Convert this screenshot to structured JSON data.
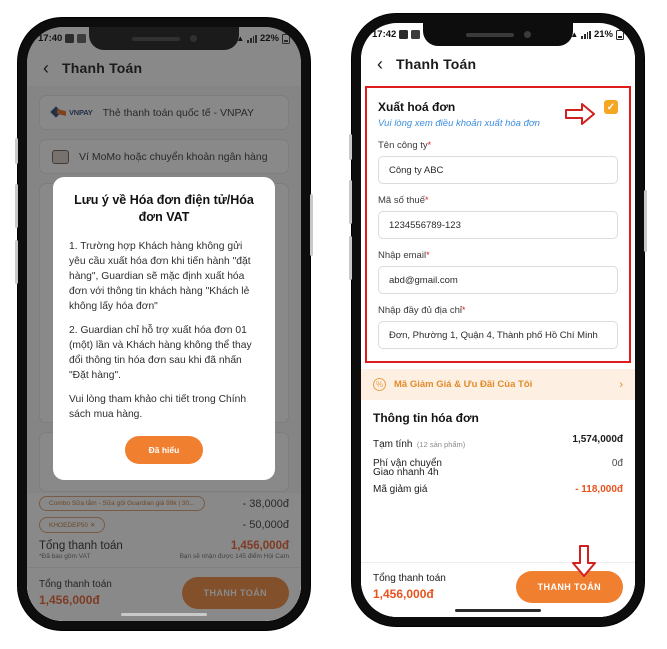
{
  "left_phone": {
    "status_bar": {
      "time": "17:40",
      "battery": "22%"
    },
    "header": {
      "back_icon": "chevron-left-icon",
      "title": "Thanh Toán"
    },
    "payment_options": [
      {
        "icon": "vnpay-logo-icon",
        "brand": "VNPAY",
        "label": "Thẻ thanh toán quốc tế - VNPAY"
      },
      {
        "icon": "momo-wallet-icon",
        "brand": "",
        "label": "Ví MoMo hoặc chuyển khoản ngân hàng"
      }
    ],
    "modal": {
      "title": "Lưu ý về Hóa đơn điện tử/Hóa đơn VAT",
      "paragraph_1": "1. Trường hợp Khách hàng không gửi yêu cầu xuất hóa đơn khi tiến hành \"đặt hàng\", Guardian sẽ mặc định xuất hóa đơn với thông tin khách hàng \"Khách lẻ không lấy hóa đơn\"",
      "paragraph_2": "2. Guardian chỉ hỗ trợ xuất hóa đơn 01 (một) lần và Khách hàng không thể thay đổi thông tin hóa đơn sau khi đã nhấn \"Đặt hàng\".",
      "paragraph_3": "Vui lòng tham khảo chi tiết trong Chính sách mua hàng.",
      "button_label": "Đã hiểu"
    },
    "summary": {
      "coupons": [
        {
          "chip": "Combo Sữa tắm - Sữa gội Guardian giá 99k | 30...",
          "value": "- 38,000đ"
        },
        {
          "chip": "KHOEDEP50  ✕",
          "value": "- 50,000đ"
        }
      ],
      "total_label": "Tổng thanh toán",
      "total_value": "1,456,000đ",
      "vat_note": "*Đã bao gồm VAT",
      "points_note": "Bạn sẽ nhận được 145 điểm Hội Cam"
    },
    "bottom_bar": {
      "total_label": "Tổng thanh toán",
      "total_value": "1,456,000đ",
      "pay_button": "THANH TOÁN"
    }
  },
  "right_phone": {
    "status_bar": {
      "time": "17:42",
      "battery": "21%"
    },
    "header": {
      "back_icon": "chevron-left-icon",
      "title": "Thanh Toán"
    },
    "invoice_section": {
      "title": "Xuất hoá đơn",
      "subtitle": "Vui lòng xem điều khoản xuất hóa đơn",
      "checkbox_checked": true,
      "checkbox_glyph": "✓",
      "fields": [
        {
          "label": "Tên công ty",
          "required": "*",
          "value": "Công ty ABC",
          "placeholder": "Tên công ty"
        },
        {
          "label": "Mã số thuế",
          "required": "*",
          "value": "1234556789-123",
          "placeholder": "Mã số thuế"
        },
        {
          "label": "Nhập email",
          "required": "*",
          "value": "abd@gmail.com",
          "placeholder": "Nhập email"
        },
        {
          "label": "Nhập đầy đủ địa chỉ",
          "required": "*",
          "value": "Đơn, Phường 1, Quận 4, Thành phố Hồ Chí Minh",
          "placeholder": "Nhập đầy đủ địa chỉ"
        }
      ]
    },
    "voucher_bar": {
      "icon": "voucher-tag-icon",
      "label": "Mã Giảm Giá & Ưu Đãi Của Tôi",
      "chevron": "›"
    },
    "invoice_info": {
      "title": "Thông tin hóa đơn",
      "rows": [
        {
          "label": "Tạm tính",
          "sub": "(12 sản phẩm)",
          "value": "1,574,000đ",
          "style": "bold"
        },
        {
          "label": "Phí vận chuyển",
          "sub2": "Giao nhanh 4h",
          "value": "0đ",
          "style": "plain"
        },
        {
          "label": "Mã giảm giá",
          "sub": "",
          "value": "- 118,000đ",
          "style": "red"
        }
      ]
    },
    "bottom_bar": {
      "total_label": "Tổng thanh toán",
      "total_value": "1,456,000đ",
      "pay_button": "THANH TOÁN"
    }
  },
  "annotations": {
    "arrow_color": "#d02020",
    "highlight_border_color": "#e01b1b",
    "arrow_right_name": "annotation-arrow-right",
    "arrow_down_name": "annotation-arrow-down"
  },
  "colors": {
    "brand_orange": "#f08030",
    "accent_red_orange": "#e8531f",
    "link_blue": "#3d8ee0",
    "checkbox_orange": "#f5a623",
    "voucher_bg": "#fdf0e2"
  }
}
